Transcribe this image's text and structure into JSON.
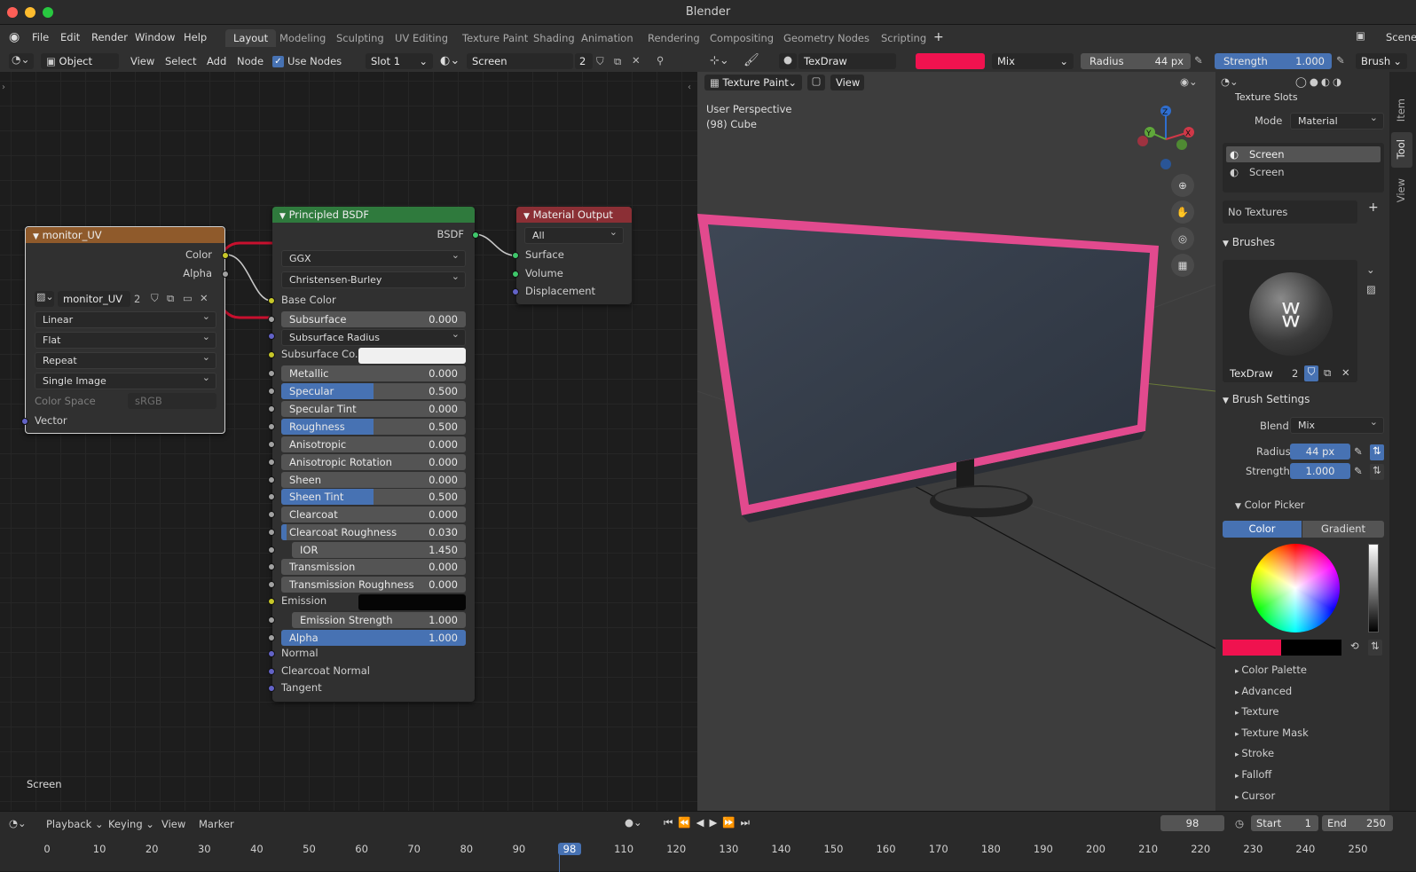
{
  "window": {
    "title": "Blender"
  },
  "menu": {
    "file": "File",
    "edit": "Edit",
    "render": "Render",
    "window": "Window",
    "help": "Help"
  },
  "workspaces": [
    "Layout",
    "Modeling",
    "Sculpting",
    "UV Editing",
    "Texture Paint",
    "Shading",
    "Animation",
    "Rendering",
    "Compositing",
    "Geometry Nodes",
    "Scripting"
  ],
  "add_workspace": "+",
  "scene": "Scene",
  "node_header": {
    "object_mode": "Object",
    "view": "View",
    "select": "Select",
    "add": "Add",
    "node": "Node",
    "use_nodes": "Use Nodes",
    "slot": "Slot 1",
    "material": "Screen",
    "material_users": "2"
  },
  "nodes": {
    "image_node": {
      "title": "monitor_UV",
      "out_color": "Color",
      "out_alpha": "Alpha",
      "image_name": "monitor_UV",
      "image_users": "2",
      "interpolation": "Linear",
      "projection": "Flat",
      "extension": "Repeat",
      "source": "Single Image",
      "color_space_label": "Color Space",
      "color_space": "sRGB",
      "in_vector": "Vector"
    },
    "bsdf": {
      "title": "Principled BSDF",
      "out": "BSDF",
      "distribution": "GGX",
      "subsurface_method": "Christensen-Burley",
      "base_color": "Base Color",
      "subsurface_radius": "Subsurface Radius",
      "subsurface_color": "Subsurface Co...",
      "emission": "Emission",
      "normal": "Normal",
      "clearcoat_normal": "Clearcoat Normal",
      "tangent": "Tangent",
      "sliders": [
        {
          "label": "Subsurface",
          "value": "0.000",
          "fill": 0
        },
        {
          "label": "Metallic",
          "value": "0.000",
          "fill": 0
        },
        {
          "label": "Specular",
          "value": "0.500",
          "fill": 0.5
        },
        {
          "label": "Specular Tint",
          "value": "0.000",
          "fill": 0
        },
        {
          "label": "Roughness",
          "value": "0.500",
          "fill": 0.5
        },
        {
          "label": "Anisotropic",
          "value": "0.000",
          "fill": 0
        },
        {
          "label": "Anisotropic Rotation",
          "value": "0.000",
          "fill": 0
        },
        {
          "label": "Sheen",
          "value": "0.000",
          "fill": 0
        },
        {
          "label": "Sheen Tint",
          "value": "0.500",
          "fill": 0.5
        },
        {
          "label": "Clearcoat",
          "value": "0.000",
          "fill": 0
        },
        {
          "label": "Clearcoat Roughness",
          "value": "0.030",
          "fill": 0.03
        },
        {
          "label": "IOR",
          "value": "1.450",
          "fill": 0
        },
        {
          "label": "Transmission",
          "value": "0.000",
          "fill": 0
        },
        {
          "label": "Transmission Roughness",
          "value": "0.000",
          "fill": 0
        },
        {
          "label": "Emission Strength",
          "value": "1.000",
          "fill": 0
        },
        {
          "label": "Alpha",
          "value": "1.000",
          "fill": 1
        }
      ]
    },
    "output": {
      "title": "Material Output",
      "target": "All",
      "surface": "Surface",
      "volume": "Volume",
      "displacement": "Displacement"
    }
  },
  "node_editor_footer": "Screen",
  "paint_header": {
    "brush_name": "TexDraw",
    "brush_color": "#f0124f",
    "blend": "Mix",
    "radius_label": "Radius",
    "radius_value": "44 px",
    "strength_label": "Strength",
    "strength_value": "1.000",
    "brush_menu": "Brush"
  },
  "viewport": {
    "mode": "Texture Paint",
    "view": "View",
    "perspective": "User Perspective",
    "object": "(98) Cube",
    "gizmo": {
      "z": "Z",
      "y": "Y",
      "x": "X"
    }
  },
  "sidebar": {
    "tabs": [
      "Item",
      "Tool",
      "View"
    ],
    "texture_slots": "Texture Slots",
    "mode_label": "Mode",
    "mode_value": "Material",
    "slots": [
      "Screen",
      "Screen"
    ],
    "no_textures": "No Textures",
    "brushes": "Brushes",
    "brush_name": "TexDraw",
    "brush_users": "2",
    "brush_settings": "Brush Settings",
    "blend_label": "Blend",
    "blend_value": "Mix",
    "radius_label": "Radius",
    "radius_value": "44 px",
    "strength_label": "Strength",
    "strength_value": "1.000",
    "color_picker": "Color Picker",
    "color_tab": "Color",
    "gradient_tab": "Gradient",
    "collapsed": [
      "Color Palette",
      "Advanced",
      "Texture",
      "Texture Mask",
      "Stroke",
      "Falloff",
      "Cursor"
    ]
  },
  "timeline": {
    "playback": "Playback",
    "keying": "Keying",
    "view": "View",
    "marker": "Marker",
    "current_frame": "98",
    "start_label": "Start",
    "start": "1",
    "end_label": "End",
    "end": "250",
    "ticks": [
      "0",
      "10",
      "20",
      "30",
      "40",
      "50",
      "60",
      "70",
      "80",
      "90",
      "98",
      "110",
      "120",
      "130",
      "140",
      "150",
      "160",
      "170",
      "180",
      "190",
      "200",
      "210",
      "220",
      "230",
      "240",
      "250"
    ]
  }
}
